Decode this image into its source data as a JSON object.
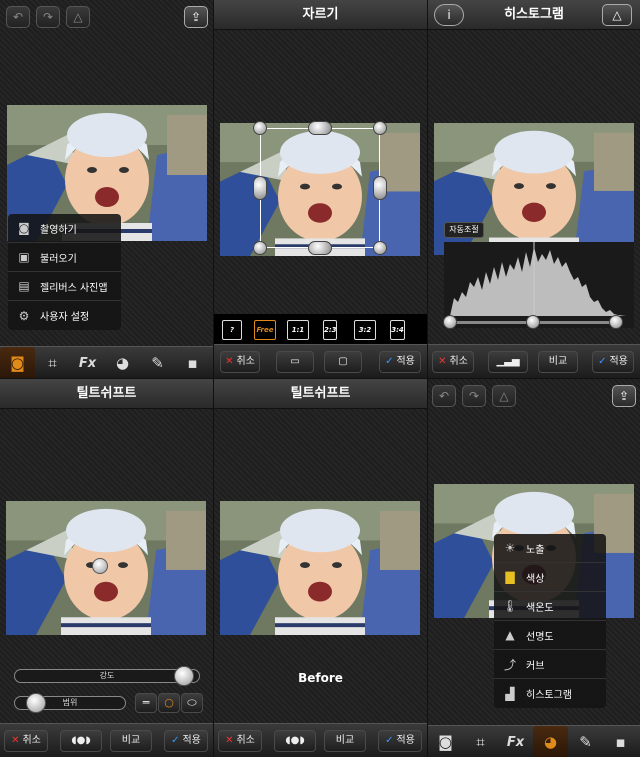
{
  "panel1": {
    "menu": [
      {
        "icon": "camera-icon",
        "label": "촬영하기"
      },
      {
        "icon": "photo-album-icon",
        "label": "불러오기"
      },
      {
        "icon": "bus-icon",
        "label": "젤리버스 사진앱"
      },
      {
        "icon": "gear-icon",
        "label": "사용자 설정"
      }
    ],
    "tools": [
      "camera-icon",
      "crop-icon",
      "effects-fx-icon",
      "palette-icon",
      "edit-export-icon",
      "save-icon"
    ]
  },
  "panel2": {
    "title": "자르기",
    "ratios": [
      "?",
      "Free",
      "1:1",
      "2:3",
      "3:2",
      "3:4"
    ],
    "cancel": "취소",
    "apply": "적용"
  },
  "panel3": {
    "title": "히스토그램",
    "auto_adjust": "자동조절",
    "cancel": "취소",
    "compare": "비교",
    "apply": "적용"
  },
  "panel4": {
    "title": "틸트쉬프트",
    "strength_label": "강도",
    "range_label": "범위",
    "cancel": "취소",
    "compare": "비교",
    "apply": "적용"
  },
  "panel5": {
    "title": "틸트쉬프트",
    "before_label": "Before",
    "cancel": "취소",
    "compare": "비교",
    "apply": "적용"
  },
  "panel6": {
    "menu": [
      {
        "icon": "sun-icon",
        "label": "노출"
      },
      {
        "icon": "color-swatch-icon",
        "label": "색상"
      },
      {
        "icon": "thermometer-icon",
        "label": "색온도"
      },
      {
        "icon": "triangle-icon",
        "label": "선명도"
      },
      {
        "icon": "curve-icon",
        "label": "커브"
      },
      {
        "icon": "histogram-icon",
        "label": "히스토그램"
      }
    ]
  },
  "colors": {
    "accent_orange": "#e08a1a",
    "check_blue": "#3399ff",
    "cancel_red": "#ee3333"
  }
}
